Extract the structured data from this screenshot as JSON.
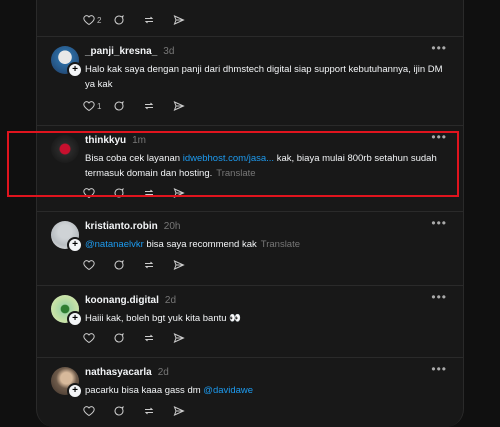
{
  "posts": [
    {
      "username": "",
      "time": "",
      "text": "",
      "likes": "2"
    },
    {
      "username": "_panji_kresna_",
      "time": "3d",
      "text": "Halo kak saya dengan panji dari dhmstech digital siap support kebutuhannya, ijin DM ya kak",
      "likes": "1"
    },
    {
      "username": "thinkkyu",
      "time": "1m",
      "text_before": "Bisa coba cek layanan ",
      "link": "idwebhost.com/jasa...",
      "text_after": " kak, biaya mulai 800rb setahun sudah termasuk domain dan hosting.",
      "translate": "Translate"
    },
    {
      "username": "kristianto.robin",
      "time": "20h",
      "mention": "@natanaelvkr",
      "text": " bisa saya recommend kak",
      "translate": "Translate"
    },
    {
      "username": "koonang.digital",
      "time": "2d",
      "text": "Haiii kak, boleh bgt yuk kita bantu 👀"
    },
    {
      "username": "nathasyacarla",
      "time": "2d",
      "text": "pacarku bisa kaaa gass dm ",
      "mention": "@davidawe"
    }
  ],
  "more_label": "•••",
  "icons": [
    "heart-icon",
    "comment-icon",
    "repost-icon",
    "share-icon",
    "plus-icon"
  ],
  "colors": {
    "background": "#101010",
    "card": "#181818",
    "link": "#1d9bf0",
    "highlight": "#e0141e"
  }
}
